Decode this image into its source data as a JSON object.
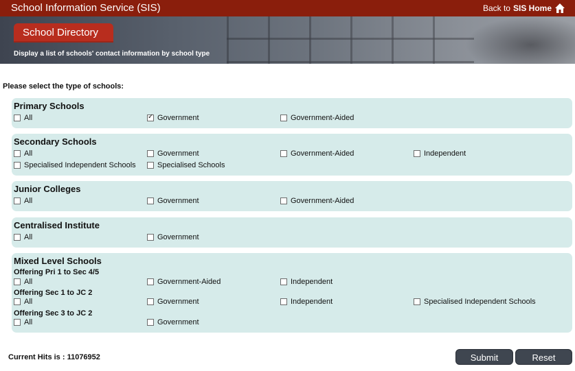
{
  "header": {
    "title": "School Information Service (SIS)",
    "back_prefix": "Back to",
    "back_link": "SIS Home"
  },
  "banner": {
    "tab": "School Directory",
    "description": "Display a list of schools' contact information by school type"
  },
  "prompt": "Please select the type of schools:",
  "groups": {
    "primary": {
      "title": "Primary Schools",
      "options": [
        {
          "label": "All",
          "checked": false
        },
        {
          "label": "Government",
          "checked": true
        },
        {
          "label": "Government-Aided",
          "checked": false
        }
      ]
    },
    "secondary": {
      "title": "Secondary Schools",
      "options": [
        {
          "label": "All",
          "checked": false
        },
        {
          "label": "Government",
          "checked": false
        },
        {
          "label": "Government-Aided",
          "checked": false
        },
        {
          "label": "Independent",
          "checked": false
        },
        {
          "label": "Specialised Independent Schools",
          "checked": false
        },
        {
          "label": "Specialised Schools",
          "checked": false
        }
      ]
    },
    "jc": {
      "title": "Junior Colleges",
      "options": [
        {
          "label": "All",
          "checked": false
        },
        {
          "label": "Government",
          "checked": false
        },
        {
          "label": "Government-Aided",
          "checked": false
        }
      ]
    },
    "ci": {
      "title": "Centralised Institute",
      "options": [
        {
          "label": "All",
          "checked": false
        },
        {
          "label": "Government",
          "checked": false
        }
      ]
    },
    "mixed": {
      "title": "Mixed Level Schools",
      "sub1": "Offering Pri 1 to Sec 4/5",
      "sub1_options": [
        {
          "label": "All",
          "checked": false
        },
        {
          "label": "Government-Aided",
          "checked": false
        },
        {
          "label": "Independent",
          "checked": false
        }
      ],
      "sub2": "Offering Sec 1 to JC 2",
      "sub2_options": [
        {
          "label": "All",
          "checked": false
        },
        {
          "label": "Government",
          "checked": false
        },
        {
          "label": "Independent",
          "checked": false
        },
        {
          "label": "Specialised Independent Schools",
          "checked": false
        }
      ],
      "sub3": "Offering Sec 3 to JC 2",
      "sub3_options": [
        {
          "label": "All",
          "checked": false
        },
        {
          "label": "Government",
          "checked": false
        }
      ]
    }
  },
  "footer": {
    "hits": "Current Hits is : 11076952",
    "submit": "Submit",
    "reset": "Reset"
  },
  "colors": {
    "header_bg": "#8a1e0c",
    "tab_bg": "#b82d1e",
    "group_bg": "#d6ebea",
    "button_bg": "#3f4650"
  }
}
